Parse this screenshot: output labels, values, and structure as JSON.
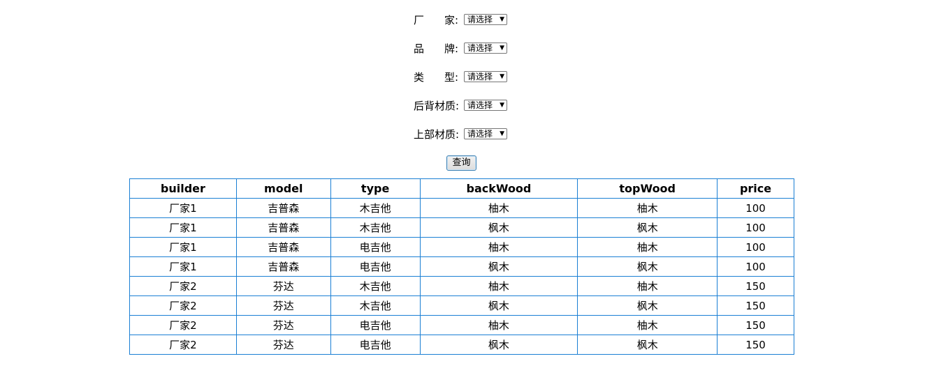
{
  "filters": [
    {
      "label_chars": [
        "厂",
        "家:"
      ],
      "selected": "请选择"
    },
    {
      "label_chars": [
        "品",
        "牌:"
      ],
      "selected": "请选择"
    },
    {
      "label_chars": [
        "类",
        "型:"
      ],
      "selected": "请选择"
    },
    {
      "label_chars": [
        "后背材质:"
      ],
      "selected": "请选择"
    },
    {
      "label_chars": [
        "上部材质:"
      ],
      "selected": "请选择"
    }
  ],
  "query_button_label": "查询",
  "table": {
    "columns": [
      "builder",
      "model",
      "type",
      "backWood",
      "topWood",
      "price"
    ],
    "rows": [
      [
        "厂家1",
        "吉普森",
        "木吉他",
        "柚木",
        "柚木",
        "100"
      ],
      [
        "厂家1",
        "吉普森",
        "木吉他",
        "枫木",
        "枫木",
        "100"
      ],
      [
        "厂家1",
        "吉普森",
        "电吉他",
        "柚木",
        "柚木",
        "100"
      ],
      [
        "厂家1",
        "吉普森",
        "电吉他",
        "枫木",
        "枫木",
        "100"
      ],
      [
        "厂家2",
        "芬达",
        "木吉他",
        "柚木",
        "柚木",
        "150"
      ],
      [
        "厂家2",
        "芬达",
        "木吉他",
        "枫木",
        "枫木",
        "150"
      ],
      [
        "厂家2",
        "芬达",
        "电吉他",
        "柚木",
        "柚木",
        "150"
      ],
      [
        "厂家2",
        "芬达",
        "电吉他",
        "枫木",
        "枫木",
        "150"
      ]
    ]
  },
  "colors": {
    "table_border": "#1a7fd4",
    "button_border": "#3c7fb1"
  }
}
